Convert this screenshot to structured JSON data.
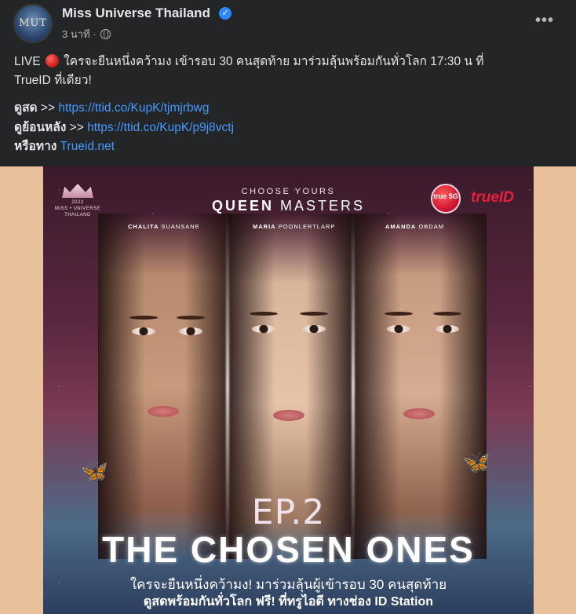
{
  "post": {
    "page_name": "Miss Universe Thailand",
    "avatar_text": "MUT",
    "time": "3 นาที",
    "separator": "·",
    "text_line1_before": "LIVE",
    "text_line1_after": "ใครจะยืนหนึ่งคว้ามง เข้ารอบ 30 คนสุดท้าย มาร่วมลุ้นพร้อมกันทั่วโลก 17:30 น ที่",
    "text_line2": "TrueID ที่เดียว!",
    "links": [
      {
        "label": "ดูสด",
        "arrow": ">>",
        "url": "https://ttid.co/KupK/tjmjrbwg"
      },
      {
        "label": "ดูย้อนหลัง",
        "arrow": ">>",
        "url": "https://ttid.co/KupK/p9j8vctj"
      },
      {
        "label": "หรือทาง",
        "arrow": "",
        "url": "Trueid.net"
      }
    ]
  },
  "poster": {
    "logo_year": "2022",
    "logo_line1": "MISS • UNIVERSE",
    "logo_line2": "THAILAND",
    "choose": "CHOOSE YOURS",
    "queen_bold": "QUEEN",
    "queen_rest": "MASTERS",
    "true5g": "true 5G",
    "trueid": "trueID",
    "contestants": [
      {
        "first": "CHALITA",
        "last": "SUANSANE"
      },
      {
        "first": "MARIA",
        "last": "POONLERTLARP"
      },
      {
        "first": "AMANDA",
        "last": "OBDAM"
      }
    ],
    "ep": "EP.2",
    "title": "THE CHOSEN ONES",
    "sub1": "ใครจะยืนหนึ่งคว้ามง! มาร่วมลุ้นผู้เข้ารอบ 30 คนสุดท้าย",
    "sub2": "ดูสดพร้อมกันทั่วโลก ฟรี! ที่ทรูไอดี ทางช่อง ID Station"
  },
  "colors": {
    "background": "#242526",
    "link": "#4599ff",
    "image_backdrop": "#e8c19a"
  }
}
